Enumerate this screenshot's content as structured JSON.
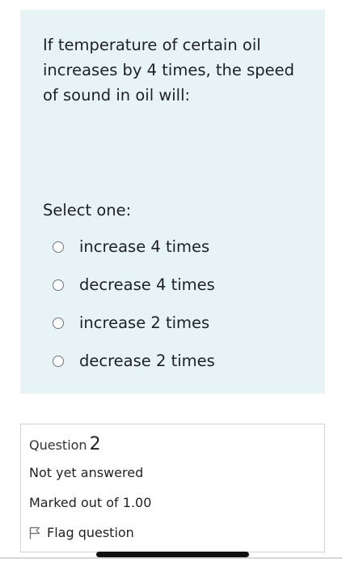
{
  "question": {
    "text": "If temperature of certain oil increases by 4 times, the speed of sound in oil will:",
    "prompt": "Select one:",
    "options": [
      {
        "label": "increase 4 times"
      },
      {
        "label": "decrease 4 times"
      },
      {
        "label": "increase 2 times"
      },
      {
        "label": "decrease 2 times"
      }
    ]
  },
  "info": {
    "question_label": "Question",
    "question_number": "2",
    "state": "Not yet answered",
    "grade": "Marked out of 1.00",
    "flag_label": "Flag question",
    "flag_icon": "flag-icon"
  },
  "colors": {
    "question_background": "#e7f3f5",
    "info_border": "#cfd4d8"
  }
}
